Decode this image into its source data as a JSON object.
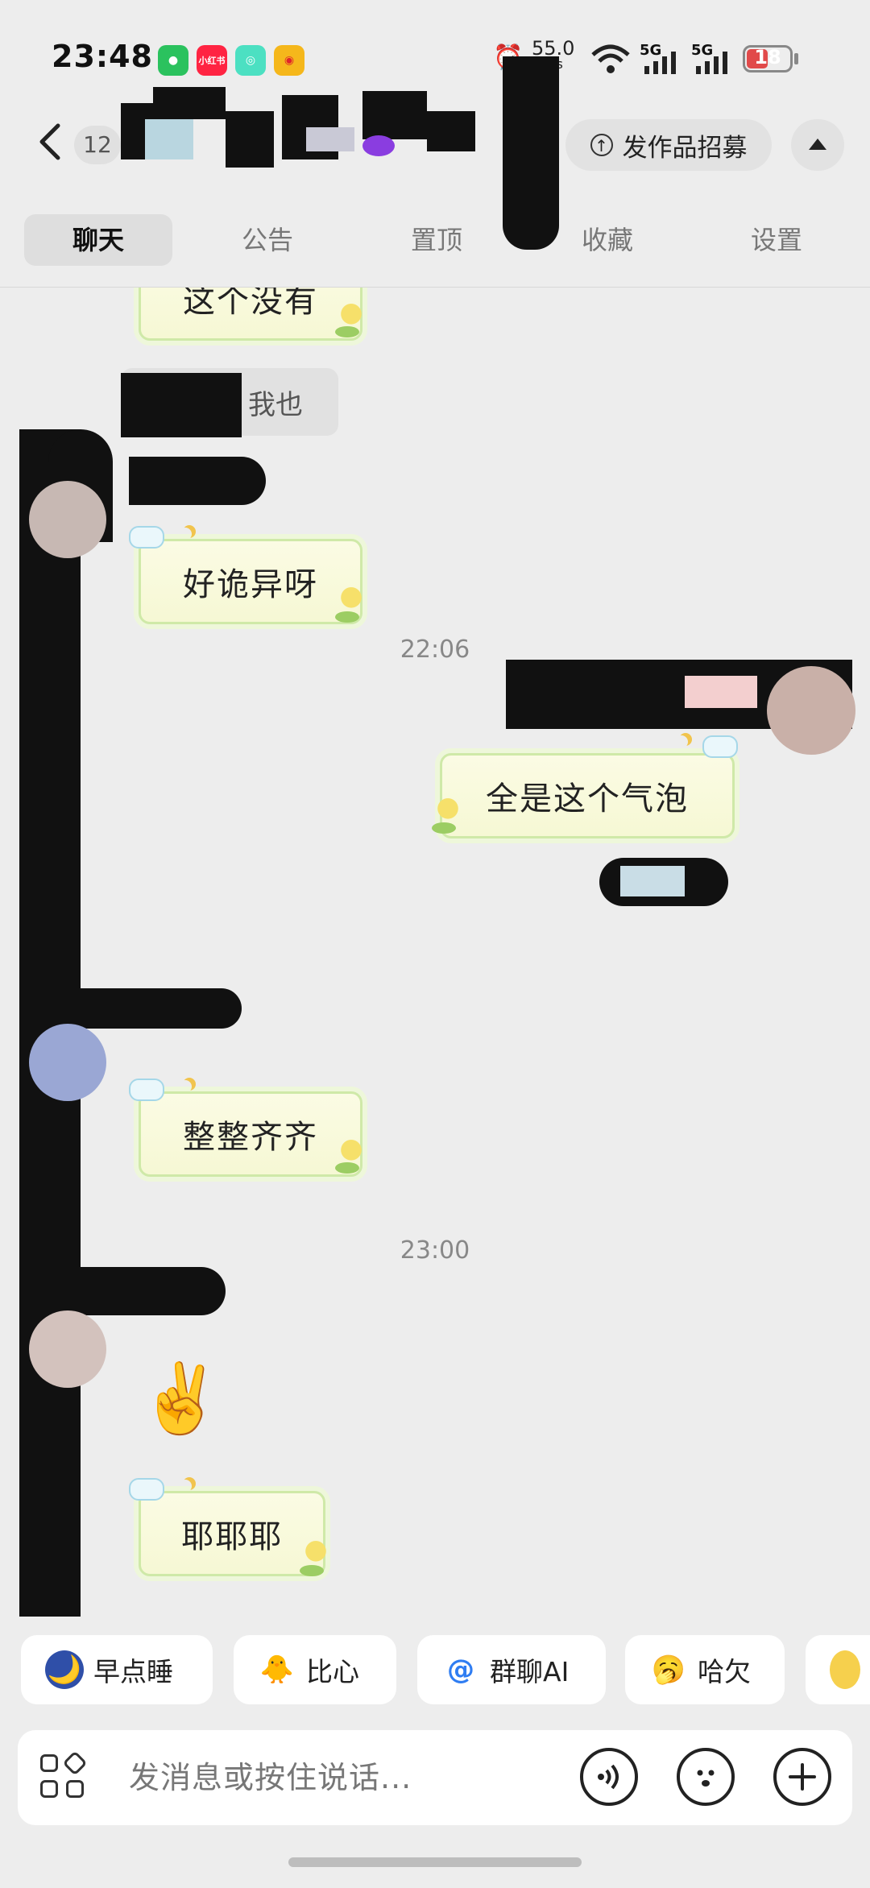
{
  "status_bar": {
    "time": "23:48",
    "apps": [
      "wechat",
      "xiaohongshu",
      "soul",
      "weibo"
    ],
    "xhs_label": "小红书",
    "network_speed": "55.0",
    "network_unit": "K/s",
    "signal_label_1": "5G",
    "signal_label_2": "5G",
    "battery_level": "18"
  },
  "header": {
    "back_icon": "chevron-left-icon",
    "unread_count": "12",
    "recruit_label": "发作品招募",
    "collapse_icon": "triangle-up-icon"
  },
  "tabs": [
    {
      "label": "聊天",
      "active": true
    },
    {
      "label": "公告",
      "active": false
    },
    {
      "label": "置顶",
      "active": false
    },
    {
      "label": "收藏",
      "active": false
    },
    {
      "label": "设置",
      "active": false
    }
  ],
  "messages": {
    "m0": "这个没有",
    "m1_partial": "我也",
    "m2": "好诡异呀",
    "m3": "全是这个气泡",
    "t1": "22:06",
    "m4": "整整齐齐",
    "t2": "23:00",
    "m5_emoji": "✌️",
    "m6": "耶耶耶"
  },
  "quick_replies": [
    {
      "icon": "🌙",
      "label": "早点睡"
    },
    {
      "icon": "🐥",
      "label": "比心"
    },
    {
      "icon": "@",
      "label": "群聊AI"
    },
    {
      "icon": "🥱",
      "label": "哈欠"
    }
  ],
  "input": {
    "placeholder": "发消息或按住说话..."
  },
  "colors": {
    "background": "#ededed",
    "bubble_border": "#cfe9a8",
    "bubble_fill": "#f8f9dc",
    "battery": "#e14a4a"
  }
}
